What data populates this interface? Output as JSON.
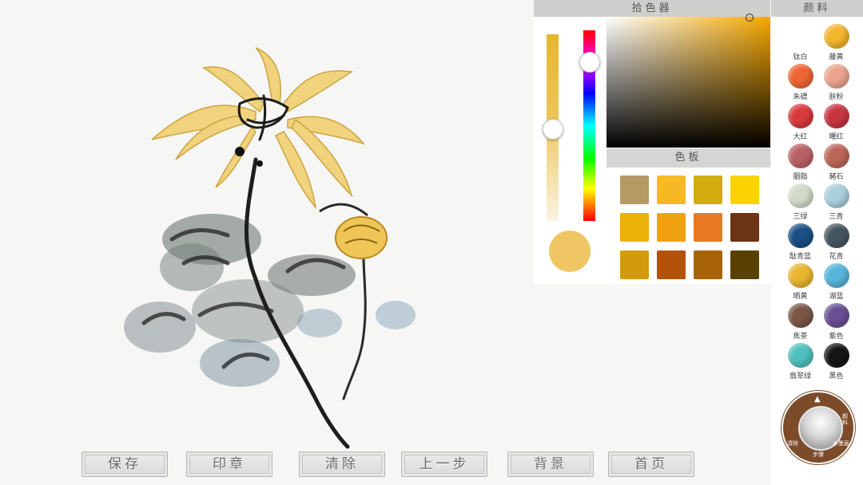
{
  "picker": {
    "title": "拾色器",
    "palette_title": "色板",
    "swatches": [
      "#b59a64",
      "#f7b825",
      "#d3ac10",
      "#fbd300",
      "#ebb20a",
      "#f1a212",
      "#ea7a22",
      "#6d3513",
      "#d49a0e",
      "#b35209",
      "#a86307",
      "#584102"
    ],
    "preview_color": "#efc35c"
  },
  "pigments": {
    "title": "颜料",
    "items": [
      {
        "name": "钛白",
        "color": "#ffffff"
      },
      {
        "name": "藤黄",
        "color": "#f2b52c"
      },
      {
        "name": "朱磦",
        "color": "#ee6433"
      },
      {
        "name": "肤粉",
        "color": "#e9a58e"
      },
      {
        "name": "大红",
        "color": "#d8393b"
      },
      {
        "name": "曙红",
        "color": "#c73541"
      },
      {
        "name": "胭脂",
        "color": "#b96166"
      },
      {
        "name": "赭石",
        "color": "#bc6659"
      },
      {
        "name": "三绿",
        "color": "#d2dac9"
      },
      {
        "name": "三青",
        "color": "#a8cfdc"
      },
      {
        "name": "酞青蓝",
        "color": "#1b4f85"
      },
      {
        "name": "花青",
        "color": "#445560"
      },
      {
        "name": "晒黄",
        "color": "#e8b52f"
      },
      {
        "name": "湖蓝",
        "color": "#57b4da"
      },
      {
        "name": "焦茶",
        "color": "#7b5647"
      },
      {
        "name": "紫色",
        "color": "#6a4e93"
      },
      {
        "name": "翡翠绿",
        "color": "#4fbfbd"
      },
      {
        "name": "黑色",
        "color": "#151515"
      }
    ]
  },
  "wheel": {
    "left_label": "清除",
    "bottom_label": "步骤",
    "right_label": "颜料",
    "lower_right_label": "水墨画"
  },
  "toolbar": {
    "save": "保存",
    "seal": "印章",
    "clear": "清除",
    "undo": "上一步",
    "background": "背景",
    "home": "首页"
  }
}
